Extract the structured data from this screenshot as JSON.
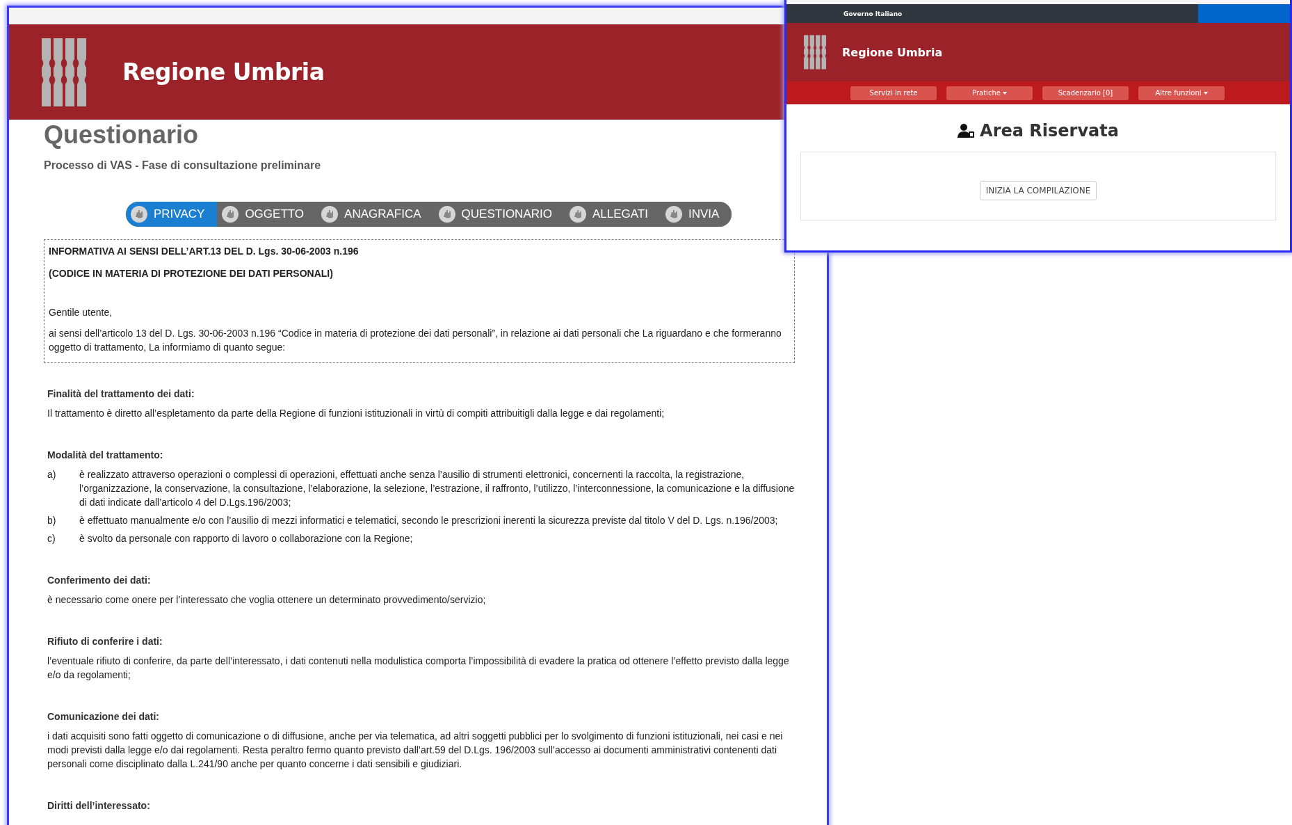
{
  "questionnaire_window": {
    "header": {
      "title": "Regione Umbria"
    },
    "page_title": "Questionario",
    "subtitle": "Processo di VAS - Fase di consultazione preliminare",
    "steps": [
      {
        "label": "PRIVACY",
        "selected": true
      },
      {
        "label": "OGGETTO",
        "selected": false
      },
      {
        "label": "ANAGRAFICA",
        "selected": false
      },
      {
        "label": "QUESTIONARIO",
        "selected": false
      },
      {
        "label": "ALLEGATI",
        "selected": false
      },
      {
        "label": "INVIA",
        "selected": false
      }
    ],
    "notice": {
      "heading_lines": [
        "INFORMATIVA AI SENSI DELL’ART.13 DEL D. Lgs. 30-06-2003 n.196",
        "(CODICE IN MATERIA DI PROTEZIONE DEI DATI PERSONALI)"
      ],
      "greeting": "Gentile utente,",
      "intro": "ai sensi dell’articolo 13 del D. Lgs. 30-06-2003 n.196 “Codice in materia di protezione dei dati personali”, in relazione ai dati personali che La riguardano e che formeranno oggetto di trattamento, La informiamo di quanto segue:"
    },
    "sections": [
      {
        "heading": "Finalità del trattamento dei dati:",
        "items": [
          {
            "kind": "paragraph",
            "text": "Il trattamento è diretto all’espletamento da parte della Regione di funzioni istituzionali in virtù di compiti attribuitigli dalla legge e dai regolamenti;"
          }
        ]
      },
      {
        "heading": "Modalità del trattamento:",
        "items": [
          {
            "kind": "list_item",
            "marker": "a)",
            "text": "è realizzato attraverso operazioni o complessi di operazioni, effettuati anche senza l’ausilio di strumenti elettronici, concernenti la raccolta, la registrazione, l’organizzazione, la conservazione, la consultazione, l’elaborazione, la selezione, l’estrazione, il raffronto, l’utilizzo, l’interconnessione, la comunicazione e la diffusione di dati indicate dall’articolo 4 del D.Lgs.196/2003;"
          },
          {
            "kind": "list_item",
            "marker": "b)",
            "text": "è effettuato manualmente e/o con l’ausilio di mezzi informatici e telematici, secondo le prescrizioni inerenti la sicurezza previste dal titolo V del D. Lgs. n.196/2003;"
          },
          {
            "kind": "list_item",
            "marker": "c)",
            "text": "è svolto da personale con rapporto di lavoro o collaborazione con la Regione;"
          }
        ]
      },
      {
        "heading": "Conferimento dei dati:",
        "items": [
          {
            "kind": "paragraph",
            "text": "è necessario come onere per l’interessato che voglia ottenere un determinato provvedimento/servizio;"
          }
        ]
      },
      {
        "heading": "Rifiuto di conferire i dati:",
        "items": [
          {
            "kind": "paragraph",
            "text": "l’eventuale rifiuto di conferire, da parte dell’interessato, i dati contenuti nella modulistica comporta l’impossibilità di evadere la pratica od ottenere l’effetto previsto dalla legge e/o da regolamenti;"
          }
        ]
      },
      {
        "heading": "Comunicazione dei dati:",
        "items": [
          {
            "kind": "paragraph",
            "text": "i dati acquisiti sono fatti oggetto di comunicazione o di diffusione, anche per via telematica, ad altri soggetti pubblici per lo svolgimento di funzioni istituzionali, nei casi e nei modi previsti dalla legge e/o dai regolamenti. Resta peraltro fermo quanto previsto dall’art.59 del D.Lgs. 196/2003 sull’accesso ai documenti amministrativi contenenti dati personali come disciplinato dalla L.241/90 anche per quanto concerne i dati sensibili e giudiziari."
          }
        ]
      },
      {
        "heading": "Diritti dell’interessato:"
      }
    ]
  },
  "reserved_area_window": {
    "top_bar": {
      "label": "Governo Italiano"
    },
    "header": {
      "title": "Regione Umbria"
    },
    "nav": [
      {
        "label": "Servizi in rete",
        "dropdown": false
      },
      {
        "label": "Pratiche",
        "dropdown": true
      },
      {
        "label": "Scadenzario [0]",
        "dropdown": false
      },
      {
        "label": "Altre funzioni",
        "dropdown": true
      }
    ],
    "heading": "Area Riservata",
    "start_button": "INIZIA LA COMPILAZIONE"
  }
}
